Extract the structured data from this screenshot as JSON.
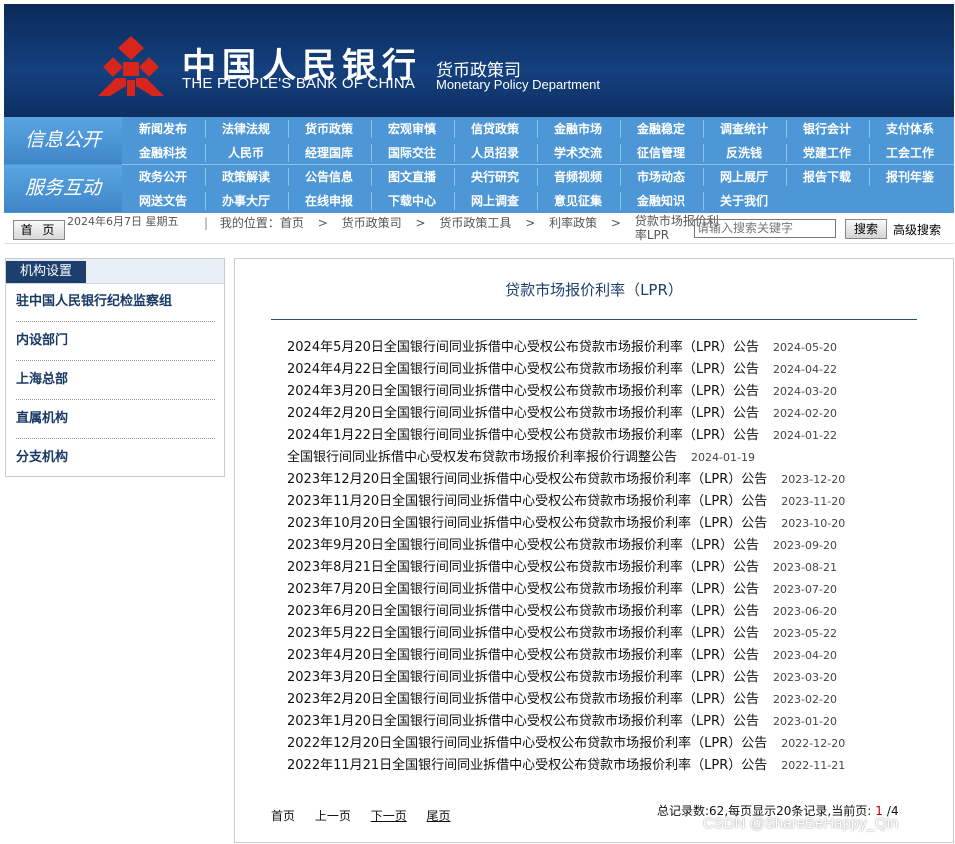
{
  "header": {
    "bank_cn": "中国人民银行",
    "bank_en": "THE PEOPLE'S BANK OF CHINA",
    "dept_cn": "货币政策司",
    "dept_en": "Monetary Policy Department",
    "emblem_color": "#d9261c"
  },
  "nav": {
    "label_info": "信息公开",
    "label_service": "服务互动",
    "row1": [
      "新闻发布",
      "法律法规",
      "货币政策",
      "宏观审慎",
      "信贷政策",
      "金融市场",
      "金融稳定",
      "调查统计",
      "银行会计",
      "支付体系"
    ],
    "row2": [
      "金融科技",
      "人民币",
      "经理国库",
      "国际交往",
      "人员招录",
      "学术交流",
      "征信管理",
      "反洗钱",
      "党建工作",
      "工会工作"
    ],
    "row3": [
      "政务公开",
      "政策解读",
      "公告信息",
      "图文直播",
      "央行研究",
      "音频视频",
      "市场动态",
      "网上展厅",
      "报告下载",
      "报刊年鉴"
    ],
    "row4": [
      "网送文告",
      "办事大厅",
      "在线申报",
      "下载中心",
      "网上调查",
      "意见征集",
      "金融知识",
      "关于我们"
    ]
  },
  "crumbbar": {
    "home": "首 页",
    "date": "2024年6月7日 星期五",
    "location_label": "我的位置：首页",
    "path": [
      "货币政策司",
      "货币政策工具",
      "利率政策",
      "贷款市场报价利率LPR"
    ],
    "search_placeholder": "请输入搜索关键字",
    "search_button": "搜索",
    "advanced": "高级搜索"
  },
  "sidebar": {
    "title": "机构设置",
    "items": [
      "驻中国人民银行纪检监察组",
      "内设部门",
      "上海总部",
      "直属机构",
      "分支机构"
    ]
  },
  "main": {
    "title": "贷款市场报价利率（LPR）",
    "items": [
      {
        "t": "2024年5月20日全国银行间同业拆借中心受权公布贷款市场报价利率（LPR）公告",
        "d": "2024-05-20"
      },
      {
        "t": "2024年4月22日全国银行间同业拆借中心受权公布贷款市场报价利率（LPR）公告",
        "d": "2024-04-22"
      },
      {
        "t": "2024年3月20日全国银行间同业拆借中心受权公布贷款市场报价利率（LPR）公告",
        "d": "2024-03-20"
      },
      {
        "t": "2024年2月20日全国银行间同业拆借中心受权公布贷款市场报价利率（LPR）公告",
        "d": "2024-02-20"
      },
      {
        "t": "2024年1月22日全国银行间同业拆借中心受权公布贷款市场报价利率（LPR）公告",
        "d": "2024-01-22"
      },
      {
        "t": "全国银行间同业拆借中心受权发布贷款市场报价利率报价行调整公告",
        "d": "2024-01-19"
      },
      {
        "t": "2023年12月20日全国银行间同业拆借中心受权公布贷款市场报价利率（LPR）公告",
        "d": "2023-12-20"
      },
      {
        "t": "2023年11月20日全国银行间同业拆借中心受权公布贷款市场报价利率（LPR）公告",
        "d": "2023-11-20"
      },
      {
        "t": "2023年10月20日全国银行间同业拆借中心受权公布贷款市场报价利率（LPR）公告",
        "d": "2023-10-20"
      },
      {
        "t": "2023年9月20日全国银行间同业拆借中心受权公布贷款市场报价利率（LPR）公告",
        "d": "2023-09-20"
      },
      {
        "t": "2023年8月21日全国银行间同业拆借中心受权公布贷款市场报价利率（LPR）公告",
        "d": "2023-08-21"
      },
      {
        "t": "2023年7月20日全国银行间同业拆借中心受权公布贷款市场报价利率（LPR）公告",
        "d": "2023-07-20"
      },
      {
        "t": "2023年6月20日全国银行间同业拆借中心受权公布贷款市场报价利率（LPR）公告",
        "d": "2023-06-20"
      },
      {
        "t": "2023年5月22日全国银行间同业拆借中心受权公布贷款市场报价利率（LPR）公告",
        "d": "2023-05-22"
      },
      {
        "t": "2023年4月20日全国银行间同业拆借中心受权公布贷款市场报价利率（LPR）公告",
        "d": "2023-04-20"
      },
      {
        "t": "2023年3月20日全国银行间同业拆借中心受权公布贷款市场报价利率（LPR）公告",
        "d": "2023-03-20"
      },
      {
        "t": "2023年2月20日全国银行间同业拆借中心受权公布贷款市场报价利率（LPR）公告",
        "d": "2023-02-20"
      },
      {
        "t": "2023年1月20日全国银行间同业拆借中心受权公布贷款市场报价利率（LPR）公告",
        "d": "2023-01-20"
      },
      {
        "t": "2022年12月20日全国银行间同业拆借中心受权公布贷款市场报价利率（LPR）公告",
        "d": "2022-12-20"
      },
      {
        "t": "2022年11月21日全国银行间同业拆借中心受权公布贷款市场报价利率（LPR）公告",
        "d": "2022-11-21"
      }
    ],
    "pager": {
      "first": "首页",
      "prev": "上一页",
      "next": "下一页",
      "last": "尾页"
    },
    "stats": {
      "prefix": "总记录数:62,每页显示20条记录,当前页:",
      "current": "1",
      "total": "/4"
    }
  },
  "watermark": "CSDN @ShareBeHappy_Qin"
}
